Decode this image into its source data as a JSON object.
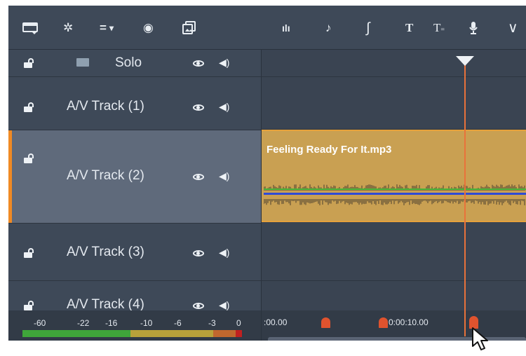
{
  "toolbar": {
    "left_icons": [
      "timeline-view-icon",
      "settings-icon",
      "dropdown-menu-icon",
      "disc-icon",
      "image-stack-icon"
    ],
    "right_icons": [
      "audio-mixer-icon",
      "music-score-icon",
      "smart-sound-icon",
      "title-icon",
      "subtitle-icon",
      "microphone-icon",
      "curve-icon"
    ],
    "icon_glyphs": {
      "title": "T",
      "subtitle": "T",
      "subtitle_sub": "=",
      "music": "♪",
      "smart": "∫",
      "curve": "∨",
      "mixer": "ılı",
      "settings": "✲",
      "dropdown": "=",
      "dropdown_arrow": "▾",
      "disc": "◉",
      "stack": "⧉"
    }
  },
  "tracks": [
    {
      "name": "Solo",
      "kind": "solo"
    },
    {
      "name": "A/V Track (1)",
      "kind": "av"
    },
    {
      "name": "A/V Track (2)",
      "kind": "av",
      "selected": true
    },
    {
      "name": "A/V Track (3)",
      "kind": "av"
    },
    {
      "name": "A/V Track (4)",
      "kind": "av"
    }
  ],
  "icons": {
    "speaker_glyph": "◀)"
  },
  "clip": {
    "title": "Feeling Ready For It.mp3",
    "color": "#c9a052"
  },
  "meter": {
    "labels": [
      "-60",
      "-22",
      "-16",
      "-10",
      "-6",
      "-3",
      "0"
    ],
    "colors": {
      "green": "#3fa63a",
      "yellow": "#b8a23a",
      "orange": "#c0672e",
      "red": "#c02020"
    }
  },
  "ruler": {
    "start_label": ":00.00",
    "mid_label": "0:00:10.00"
  },
  "accent": "#f08a24",
  "playhead_color": "#e8723a"
}
